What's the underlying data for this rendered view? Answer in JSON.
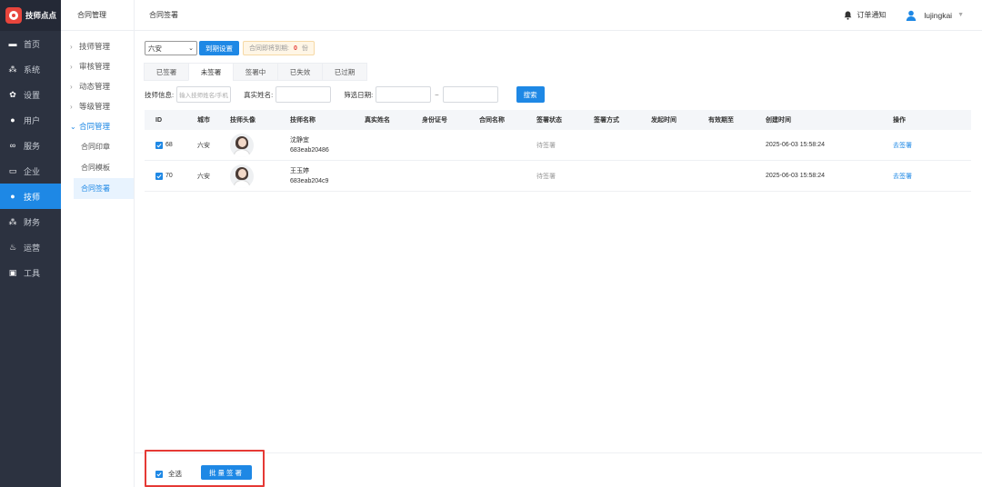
{
  "brand": {
    "name": "技师点点"
  },
  "sidebar": {
    "items": [
      {
        "label": "首页",
        "icon": "monitor-icon",
        "active": false
      },
      {
        "label": "系统",
        "icon": "sitemap-icon",
        "active": false
      },
      {
        "label": "设置",
        "icon": "gear-icon",
        "active": false
      },
      {
        "label": "用户",
        "icon": "user-icon",
        "active": false
      },
      {
        "label": "服务",
        "icon": "link-icon",
        "active": false
      },
      {
        "label": "企业",
        "icon": "building-icon",
        "active": false
      },
      {
        "label": "技师",
        "icon": "technician-icon",
        "active": true
      },
      {
        "label": "财务",
        "icon": "sitemap-icon",
        "active": false
      },
      {
        "label": "运营",
        "icon": "fire-icon",
        "active": false
      },
      {
        "label": "工具",
        "icon": "toolbox-icon",
        "active": false
      }
    ]
  },
  "submenu": {
    "title": "合同管理",
    "groups": [
      {
        "label": "技师管理"
      },
      {
        "label": "审核管理"
      },
      {
        "label": "动态管理"
      },
      {
        "label": "等级管理"
      },
      {
        "label": "合同管理"
      }
    ],
    "children": [
      {
        "label": "合同印章"
      },
      {
        "label": "合同模板"
      },
      {
        "label": "合同签署"
      }
    ]
  },
  "header": {
    "breadcrumb": "合同签署",
    "notice_label": "订单通知",
    "username": "lujingkai"
  },
  "filters": {
    "city_value": "六安",
    "expire_button": "到期设置",
    "expire_tip_prefix": "合同即将到期:",
    "expire_count": "0",
    "expire_tip_suffix": "份"
  },
  "tabs": [
    {
      "label": "已签署"
    },
    {
      "label": "未签署"
    },
    {
      "label": "签署中"
    },
    {
      "label": "已失效"
    },
    {
      "label": "已过期"
    }
  ],
  "search": {
    "info_label": "技师信息:",
    "info_placeholder": "输入技师姓名/手机",
    "name_label": "真实姓名:",
    "date_label": "筛选日期:",
    "date_separator": "~",
    "button": "搜索"
  },
  "table": {
    "columns": [
      "ID",
      "城市",
      "技师头像",
      "技师名称",
      "真实姓名",
      "身份证号",
      "合同名称",
      "签署状态",
      "签署方式",
      "发起时间",
      "有效期至",
      "创建时间",
      "操作"
    ],
    "rows": [
      {
        "id": "68",
        "city": "六安",
        "name": "沈静宜",
        "code": "683eab20486",
        "status": "待签署",
        "created": "2025-06-03 15:58:24",
        "action": "去签署"
      },
      {
        "id": "70",
        "city": "六安",
        "name": "王玉婷",
        "code": "683eab204c9",
        "status": "待签署",
        "created": "2025-06-03 15:58:24",
        "action": "去签署"
      }
    ]
  },
  "footer": {
    "select_all": "全选",
    "batch_button": "批量签署"
  },
  "colors": {
    "primary": "#1e88e5",
    "sidebar_bg": "#2c3240",
    "highlight_border": "#e53935"
  }
}
